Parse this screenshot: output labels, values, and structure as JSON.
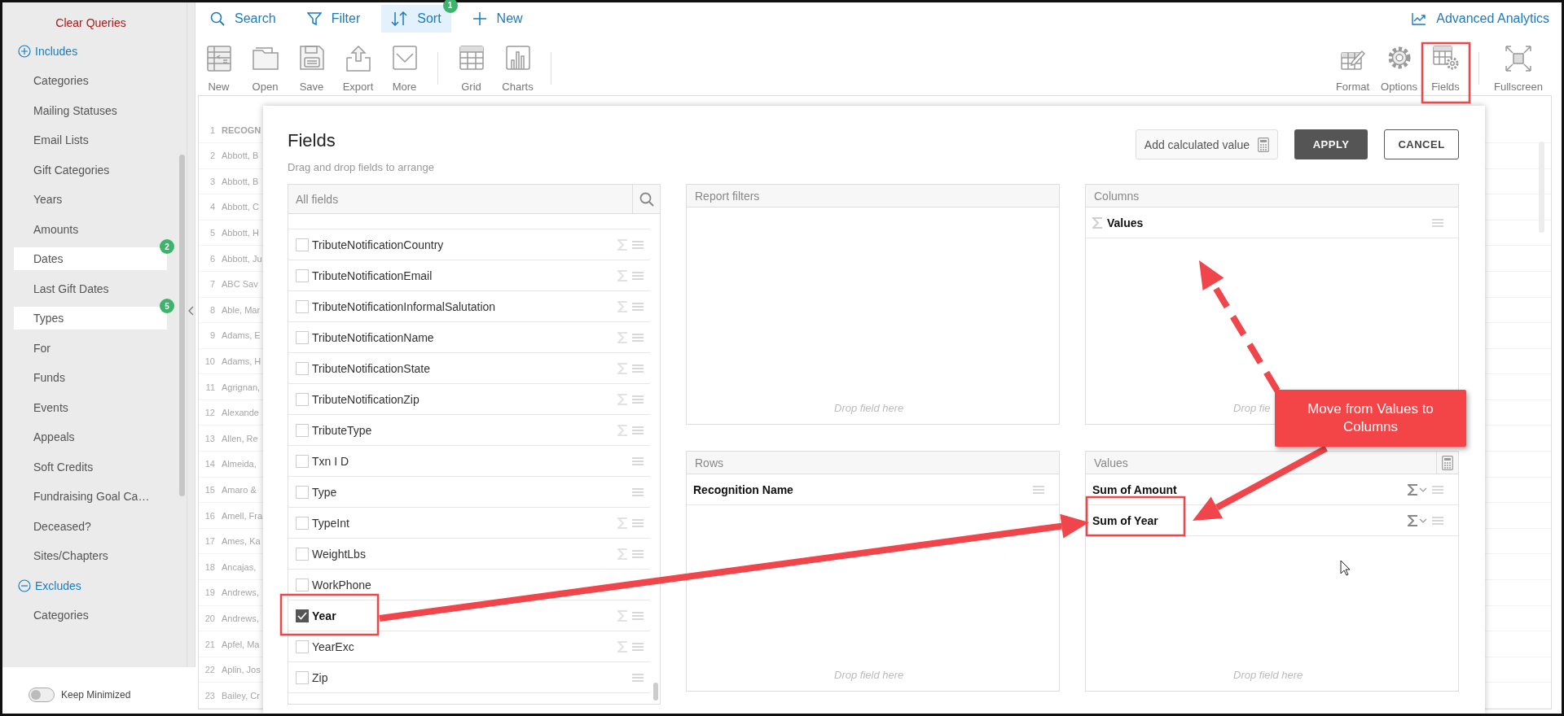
{
  "sidebar": {
    "clear_queries": "Clear Queries",
    "sections": [
      {
        "title": "Includes",
        "items": [
          {
            "label": "Categories",
            "selected": false
          },
          {
            "label": "Mailing Statuses",
            "selected": false
          },
          {
            "label": "Email Lists",
            "selected": false
          },
          {
            "label": "Gift Categories",
            "selected": false
          },
          {
            "label": "Years",
            "selected": false
          },
          {
            "label": "Amounts",
            "selected": false
          },
          {
            "label": "Dates",
            "selected": true,
            "badge": "2"
          },
          {
            "label": "Last Gift Dates",
            "selected": false
          },
          {
            "label": "Types",
            "selected": true,
            "badge": "5"
          },
          {
            "label": "For",
            "selected": false
          },
          {
            "label": "Funds",
            "selected": false
          },
          {
            "label": "Events",
            "selected": false
          },
          {
            "label": "Appeals",
            "selected": false
          },
          {
            "label": "Soft Credits",
            "selected": false
          },
          {
            "label": "Fundraising Goal Ca…",
            "selected": false
          },
          {
            "label": "Deceased?",
            "selected": false
          },
          {
            "label": "Sites/Chapters",
            "selected": false
          }
        ]
      },
      {
        "title": "Excludes",
        "items": [
          {
            "label": "Categories",
            "selected": false
          }
        ]
      }
    ],
    "keep_minimized": {
      "label": "Keep Minimized",
      "on": false
    }
  },
  "top_nav": [
    {
      "label": "Search",
      "selected": false
    },
    {
      "label": "Filter",
      "selected": false
    },
    {
      "label": "Sort",
      "selected": true,
      "badge": "1"
    },
    {
      "label": "New",
      "selected": false
    }
  ],
  "advanced_analytics": "Advanced Analytics",
  "toolbar": {
    "left": [
      [
        "New",
        "Open",
        "Save",
        "Export",
        "More"
      ],
      [
        "Grid",
        "Charts"
      ]
    ],
    "right": [
      [
        "Format",
        "Options",
        "Fields"
      ],
      [
        "Fullscreen"
      ]
    ]
  },
  "grid": {
    "header": {
      "number": "1",
      "name": "RECOGN"
    },
    "rows": [
      {
        "number": "2",
        "name": "Abbott, B"
      },
      {
        "number": "3",
        "name": "Abbott, B"
      },
      {
        "number": "4",
        "name": "Abbott, C"
      },
      {
        "number": "5",
        "name": "Abbott, H"
      },
      {
        "number": "6",
        "name": "Abbott, Ju"
      },
      {
        "number": "7",
        "name": "ABC Sav"
      },
      {
        "number": "8",
        "name": "Able, Mar"
      },
      {
        "number": "9",
        "name": "Adams, E"
      },
      {
        "number": "10",
        "name": "Adams, H"
      },
      {
        "number": "11",
        "name": "Agrignan,"
      },
      {
        "number": "12",
        "name": "Alexande"
      },
      {
        "number": "13",
        "name": "Allen, Re"
      },
      {
        "number": "14",
        "name": "Almeida,"
      },
      {
        "number": "15",
        "name": "Amaro &"
      },
      {
        "number": "16",
        "name": "Amell, Fra"
      },
      {
        "number": "17",
        "name": "Ames, Ka"
      },
      {
        "number": "18",
        "name": "Ancajas,"
      },
      {
        "number": "19",
        "name": "Andrews,"
      },
      {
        "number": "20",
        "name": "Andrews,"
      },
      {
        "number": "21",
        "name": "Apfel, Ma"
      },
      {
        "number": "22",
        "name": "Aplin, Jos"
      },
      {
        "number": "23",
        "name": "Bailey, Cr"
      }
    ]
  },
  "fields_dialog": {
    "title": "Fields",
    "subtitle": "Drag and drop fields to arrange",
    "add_calculated": "Add calculated value",
    "apply": "APPLY",
    "cancel": "CANCEL",
    "all_fields": {
      "title": "All fields",
      "items": [
        {
          "name": "TributeNotificationCountry",
          "checked": false,
          "sigma": true,
          "handle": true
        },
        {
          "name": "TributeNotificationEmail",
          "checked": false,
          "sigma": true,
          "handle": true
        },
        {
          "name": "TributeNotificationInformalSalutation",
          "checked": false,
          "sigma": true,
          "handle": true
        },
        {
          "name": "TributeNotificationName",
          "checked": false,
          "sigma": true,
          "handle": true
        },
        {
          "name": "TributeNotificationState",
          "checked": false,
          "sigma": true,
          "handle": true
        },
        {
          "name": "TributeNotificationZip",
          "checked": false,
          "sigma": true,
          "handle": true
        },
        {
          "name": "TributeType",
          "checked": false,
          "sigma": true,
          "handle": true
        },
        {
          "name": "Txn I D",
          "checked": false,
          "sigma": false,
          "handle": true
        },
        {
          "name": "Type",
          "checked": false,
          "sigma": false,
          "handle": true
        },
        {
          "name": "TypeInt",
          "checked": false,
          "sigma": true,
          "handle": true
        },
        {
          "name": "WeightLbs",
          "checked": false,
          "sigma": true,
          "handle": true
        },
        {
          "name": "WorkPhone",
          "checked": false,
          "sigma": false,
          "handle": false
        },
        {
          "name": "Year",
          "checked": true,
          "sigma": true,
          "handle": true
        },
        {
          "name": "YearExc",
          "checked": false,
          "sigma": true,
          "handle": true
        },
        {
          "name": "Zip",
          "checked": false,
          "sigma": false,
          "handle": true
        }
      ]
    },
    "panels": [
      {
        "title": "Report filters",
        "hint": "Drop field here"
      },
      {
        "title": "Columns",
        "hint": "Drop fie",
        "items": [
          {
            "label": "Values",
            "kind": "values"
          }
        ]
      },
      {
        "title": "Rows",
        "hint": "Drop field here",
        "items": [
          {
            "label": "Recognition Name",
            "kind": "row"
          }
        ]
      },
      {
        "title": "Values",
        "hint": "Drop field here",
        "calculator": true,
        "items": [
          {
            "label": "Sum of Amount",
            "kind": "value"
          },
          {
            "label": "Sum of Year",
            "kind": "value"
          }
        ]
      }
    ]
  },
  "annotation": {
    "callout": "Move from Values to Columns"
  }
}
